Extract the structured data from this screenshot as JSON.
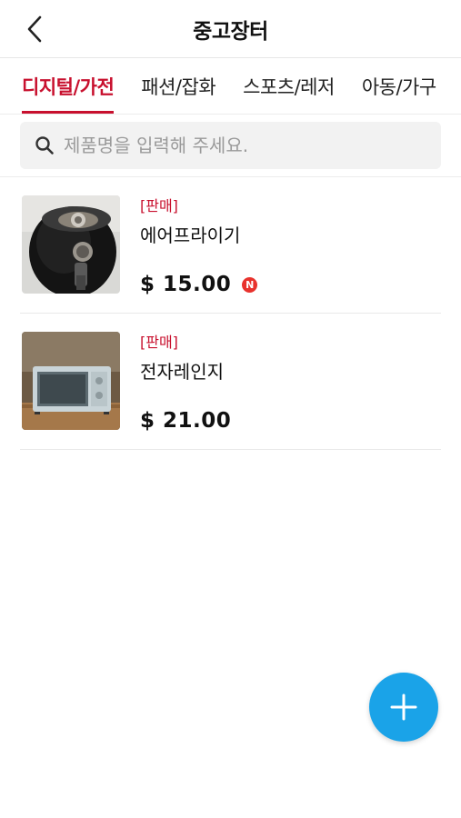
{
  "header": {
    "title": "중고장터",
    "back_icon": "chevron-left-icon"
  },
  "tabs": [
    {
      "label": "디지털/가전",
      "active": true
    },
    {
      "label": "패션/잡화",
      "active": false
    },
    {
      "label": "스포츠/레저",
      "active": false
    },
    {
      "label": "아동/가구",
      "active": false
    }
  ],
  "search": {
    "placeholder": "제품명을 입력해 주세요.",
    "value": ""
  },
  "items": [
    {
      "badge": "[판매]",
      "name": "에어프라이기",
      "price": "$ 15.00",
      "new_badge": "N",
      "image": "air-fryer-photo"
    },
    {
      "badge": "[판매]",
      "name": "전자레인지",
      "price": "$ 21.00",
      "image": "microwave-photo"
    }
  ],
  "fab": {
    "icon": "plus-icon"
  },
  "colors": {
    "accent": "#c8102e",
    "fab": "#1aa3e8",
    "new_badge": "#e8322d"
  }
}
